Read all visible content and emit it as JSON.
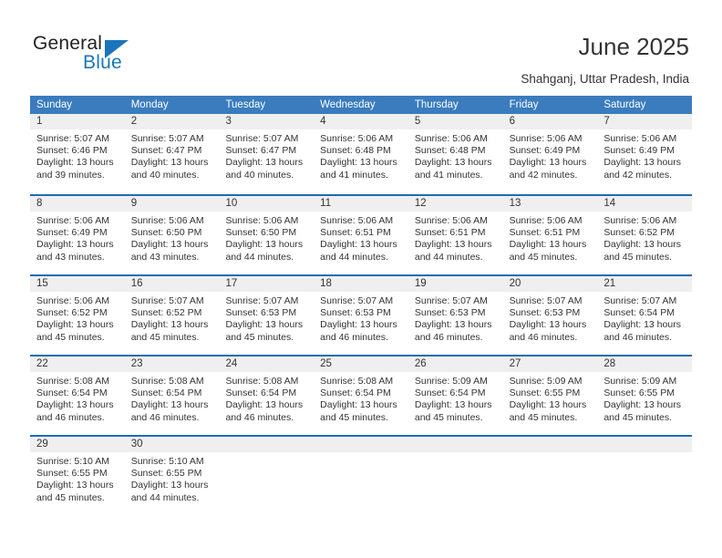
{
  "brand": {
    "name_part1": "General",
    "name_part2": "Blue",
    "accent_color": "#1b75bb"
  },
  "header": {
    "title": "June 2025",
    "location": "Shahganj, Uttar Pradesh, India"
  },
  "calendar": {
    "header_bg": "#3a7cbe",
    "row_divider": "#1f6cb0",
    "day_band_bg": "#efefef",
    "weekdays": [
      "Sunday",
      "Monday",
      "Tuesday",
      "Wednesday",
      "Thursday",
      "Friday",
      "Saturday"
    ],
    "weeks": [
      [
        {
          "day": "1",
          "sunrise": "Sunrise: 5:07 AM",
          "sunset": "Sunset: 6:46 PM",
          "daylight_l1": "Daylight: 13 hours",
          "daylight_l2": "and 39 minutes."
        },
        {
          "day": "2",
          "sunrise": "Sunrise: 5:07 AM",
          "sunset": "Sunset: 6:47 PM",
          "daylight_l1": "Daylight: 13 hours",
          "daylight_l2": "and 40 minutes."
        },
        {
          "day": "3",
          "sunrise": "Sunrise: 5:07 AM",
          "sunset": "Sunset: 6:47 PM",
          "daylight_l1": "Daylight: 13 hours",
          "daylight_l2": "and 40 minutes."
        },
        {
          "day": "4",
          "sunrise": "Sunrise: 5:06 AM",
          "sunset": "Sunset: 6:48 PM",
          "daylight_l1": "Daylight: 13 hours",
          "daylight_l2": "and 41 minutes."
        },
        {
          "day": "5",
          "sunrise": "Sunrise: 5:06 AM",
          "sunset": "Sunset: 6:48 PM",
          "daylight_l1": "Daylight: 13 hours",
          "daylight_l2": "and 41 minutes."
        },
        {
          "day": "6",
          "sunrise": "Sunrise: 5:06 AM",
          "sunset": "Sunset: 6:49 PM",
          "daylight_l1": "Daylight: 13 hours",
          "daylight_l2": "and 42 minutes."
        },
        {
          "day": "7",
          "sunrise": "Sunrise: 5:06 AM",
          "sunset": "Sunset: 6:49 PM",
          "daylight_l1": "Daylight: 13 hours",
          "daylight_l2": "and 42 minutes."
        }
      ],
      [
        {
          "day": "8",
          "sunrise": "Sunrise: 5:06 AM",
          "sunset": "Sunset: 6:49 PM",
          "daylight_l1": "Daylight: 13 hours",
          "daylight_l2": "and 43 minutes."
        },
        {
          "day": "9",
          "sunrise": "Sunrise: 5:06 AM",
          "sunset": "Sunset: 6:50 PM",
          "daylight_l1": "Daylight: 13 hours",
          "daylight_l2": "and 43 minutes."
        },
        {
          "day": "10",
          "sunrise": "Sunrise: 5:06 AM",
          "sunset": "Sunset: 6:50 PM",
          "daylight_l1": "Daylight: 13 hours",
          "daylight_l2": "and 44 minutes."
        },
        {
          "day": "11",
          "sunrise": "Sunrise: 5:06 AM",
          "sunset": "Sunset: 6:51 PM",
          "daylight_l1": "Daylight: 13 hours",
          "daylight_l2": "and 44 minutes."
        },
        {
          "day": "12",
          "sunrise": "Sunrise: 5:06 AM",
          "sunset": "Sunset: 6:51 PM",
          "daylight_l1": "Daylight: 13 hours",
          "daylight_l2": "and 44 minutes."
        },
        {
          "day": "13",
          "sunrise": "Sunrise: 5:06 AM",
          "sunset": "Sunset: 6:51 PM",
          "daylight_l1": "Daylight: 13 hours",
          "daylight_l2": "and 45 minutes."
        },
        {
          "day": "14",
          "sunrise": "Sunrise: 5:06 AM",
          "sunset": "Sunset: 6:52 PM",
          "daylight_l1": "Daylight: 13 hours",
          "daylight_l2": "and 45 minutes."
        }
      ],
      [
        {
          "day": "15",
          "sunrise": "Sunrise: 5:06 AM",
          "sunset": "Sunset: 6:52 PM",
          "daylight_l1": "Daylight: 13 hours",
          "daylight_l2": "and 45 minutes."
        },
        {
          "day": "16",
          "sunrise": "Sunrise: 5:07 AM",
          "sunset": "Sunset: 6:52 PM",
          "daylight_l1": "Daylight: 13 hours",
          "daylight_l2": "and 45 minutes."
        },
        {
          "day": "17",
          "sunrise": "Sunrise: 5:07 AM",
          "sunset": "Sunset: 6:53 PM",
          "daylight_l1": "Daylight: 13 hours",
          "daylight_l2": "and 45 minutes."
        },
        {
          "day": "18",
          "sunrise": "Sunrise: 5:07 AM",
          "sunset": "Sunset: 6:53 PM",
          "daylight_l1": "Daylight: 13 hours",
          "daylight_l2": "and 46 minutes."
        },
        {
          "day": "19",
          "sunrise": "Sunrise: 5:07 AM",
          "sunset": "Sunset: 6:53 PM",
          "daylight_l1": "Daylight: 13 hours",
          "daylight_l2": "and 46 minutes."
        },
        {
          "day": "20",
          "sunrise": "Sunrise: 5:07 AM",
          "sunset": "Sunset: 6:53 PM",
          "daylight_l1": "Daylight: 13 hours",
          "daylight_l2": "and 46 minutes."
        },
        {
          "day": "21",
          "sunrise": "Sunrise: 5:07 AM",
          "sunset": "Sunset: 6:54 PM",
          "daylight_l1": "Daylight: 13 hours",
          "daylight_l2": "and 46 minutes."
        }
      ],
      [
        {
          "day": "22",
          "sunrise": "Sunrise: 5:08 AM",
          "sunset": "Sunset: 6:54 PM",
          "daylight_l1": "Daylight: 13 hours",
          "daylight_l2": "and 46 minutes."
        },
        {
          "day": "23",
          "sunrise": "Sunrise: 5:08 AM",
          "sunset": "Sunset: 6:54 PM",
          "daylight_l1": "Daylight: 13 hours",
          "daylight_l2": "and 46 minutes."
        },
        {
          "day": "24",
          "sunrise": "Sunrise: 5:08 AM",
          "sunset": "Sunset: 6:54 PM",
          "daylight_l1": "Daylight: 13 hours",
          "daylight_l2": "and 46 minutes."
        },
        {
          "day": "25",
          "sunrise": "Sunrise: 5:08 AM",
          "sunset": "Sunset: 6:54 PM",
          "daylight_l1": "Daylight: 13 hours",
          "daylight_l2": "and 45 minutes."
        },
        {
          "day": "26",
          "sunrise": "Sunrise: 5:09 AM",
          "sunset": "Sunset: 6:54 PM",
          "daylight_l1": "Daylight: 13 hours",
          "daylight_l2": "and 45 minutes."
        },
        {
          "day": "27",
          "sunrise": "Sunrise: 5:09 AM",
          "sunset": "Sunset: 6:55 PM",
          "daylight_l1": "Daylight: 13 hours",
          "daylight_l2": "and 45 minutes."
        },
        {
          "day": "28",
          "sunrise": "Sunrise: 5:09 AM",
          "sunset": "Sunset: 6:55 PM",
          "daylight_l1": "Daylight: 13 hours",
          "daylight_l2": "and 45 minutes."
        }
      ],
      [
        {
          "day": "29",
          "sunrise": "Sunrise: 5:10 AM",
          "sunset": "Sunset: 6:55 PM",
          "daylight_l1": "Daylight: 13 hours",
          "daylight_l2": "and 45 minutes."
        },
        {
          "day": "30",
          "sunrise": "Sunrise: 5:10 AM",
          "sunset": "Sunset: 6:55 PM",
          "daylight_l1": "Daylight: 13 hours",
          "daylight_l2": "and 44 minutes."
        },
        {
          "day": "",
          "sunrise": "",
          "sunset": "",
          "daylight_l1": "",
          "daylight_l2": ""
        },
        {
          "day": "",
          "sunrise": "",
          "sunset": "",
          "daylight_l1": "",
          "daylight_l2": ""
        },
        {
          "day": "",
          "sunrise": "",
          "sunset": "",
          "daylight_l1": "",
          "daylight_l2": ""
        },
        {
          "day": "",
          "sunrise": "",
          "sunset": "",
          "daylight_l1": "",
          "daylight_l2": ""
        },
        {
          "day": "",
          "sunrise": "",
          "sunset": "",
          "daylight_l1": "",
          "daylight_l2": ""
        }
      ]
    ]
  }
}
